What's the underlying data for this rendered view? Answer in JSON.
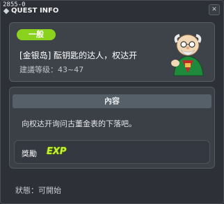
{
  "window": {
    "quest_id": "2855-0",
    "title": "QUEST INFO"
  },
  "quest": {
    "category_badge": "一般",
    "name": "[金银岛] 酝钥匙的达人，权达开",
    "level_label": "建議等级：43~47"
  },
  "content": {
    "header": "內容",
    "description": "向权达开询问古董金表的下落吧。"
  },
  "reward": {
    "label": "獎勵",
    "items": [
      {
        "icon": "exp-icon",
        "text": "EXP"
      }
    ]
  },
  "status": {
    "text": "狀態：可開始"
  },
  "colors": {
    "badge": "#8ad21d",
    "window_bg": "#2d3037",
    "panel_bg": "#3e4249",
    "header_bg": "#566068",
    "exp": "#c8f23a"
  }
}
